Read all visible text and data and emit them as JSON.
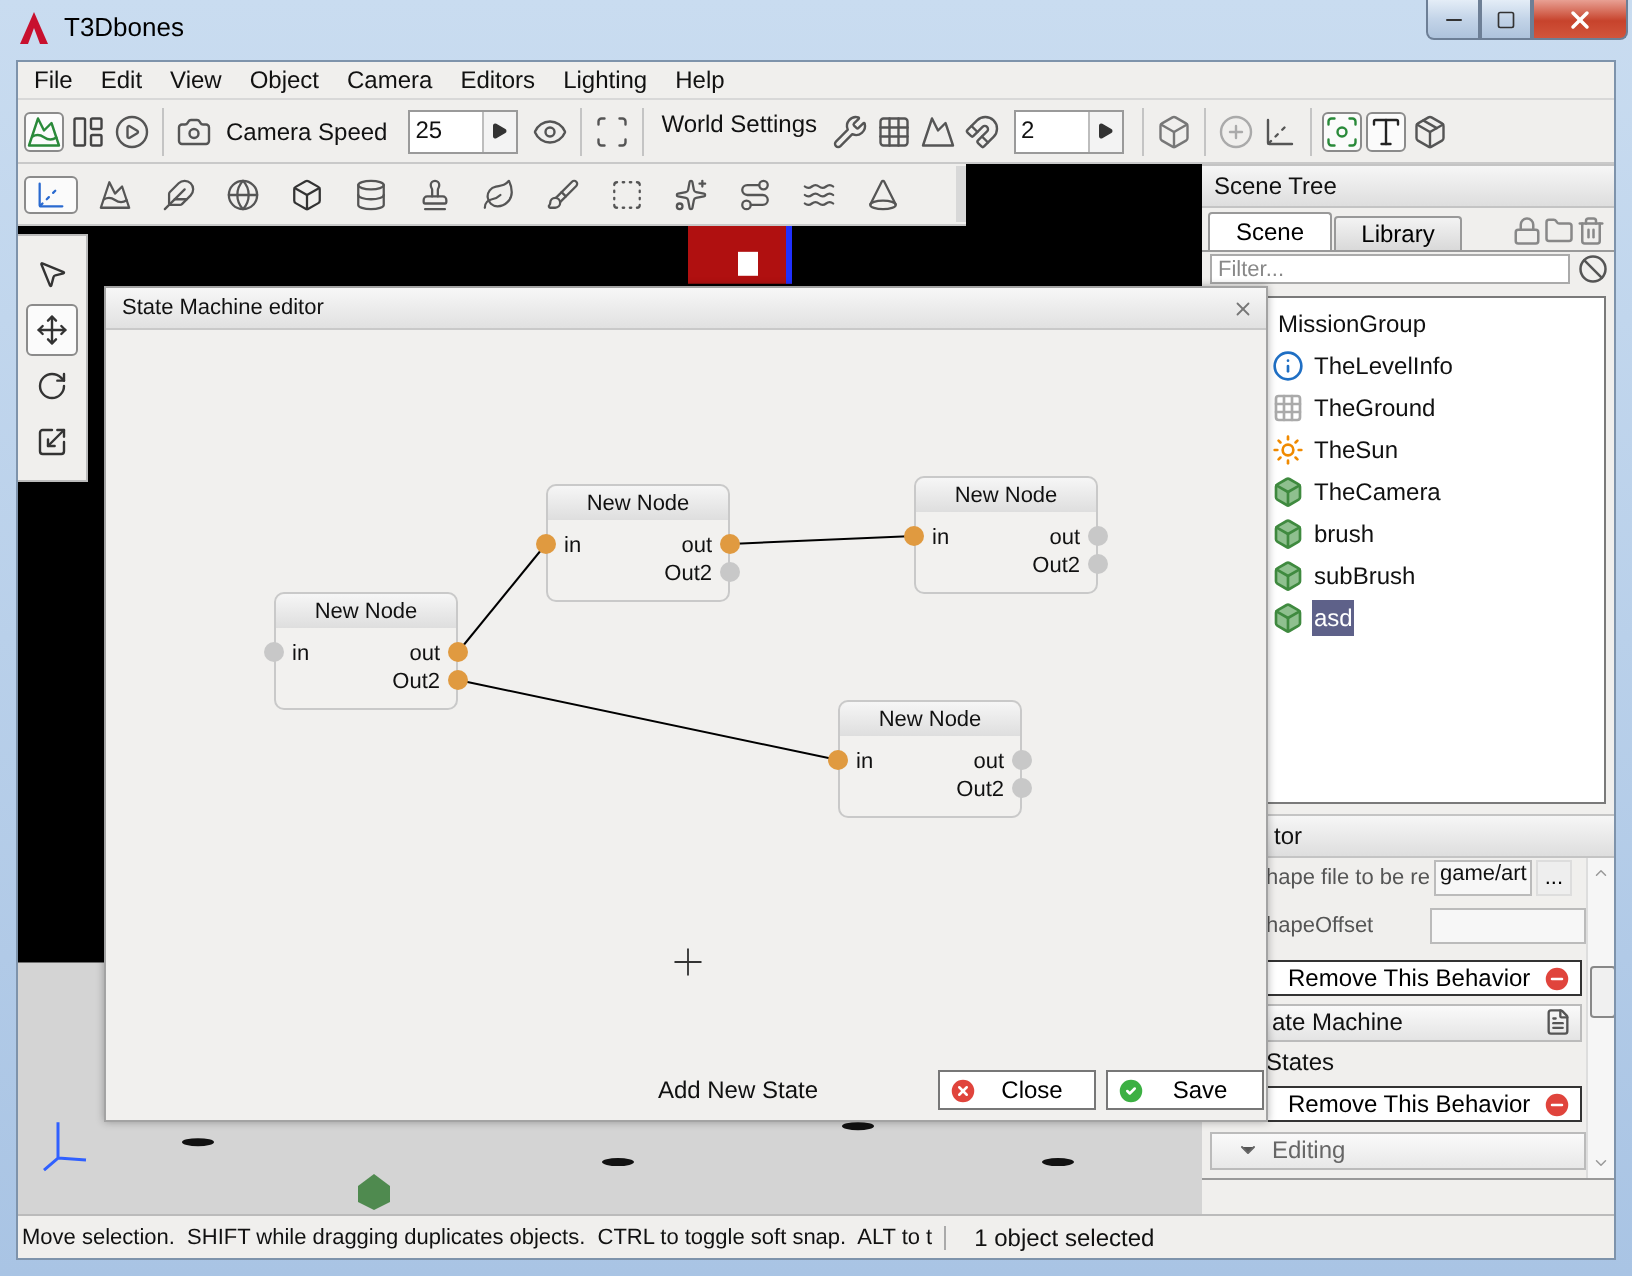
{
  "window": {
    "title": "T3Dbones"
  },
  "menu": [
    "File",
    "Edit",
    "View",
    "Object",
    "Camera",
    "Editors",
    "Lighting",
    "Help"
  ],
  "toolbar": {
    "items": [
      {
        "kind": "tool",
        "selected": true
      },
      {
        "kind": "tool",
        "selected": false
      },
      {
        "kind": "tool",
        "selected": false
      },
      {
        "kind": "separator"
      },
      {
        "kind": "tool",
        "selected": false
      },
      {
        "kind": "label",
        "text": "Camera Speed"
      },
      {
        "kind": "spin",
        "value": "25"
      },
      {
        "kind": "tool",
        "selected": false
      },
      {
        "kind": "separator"
      },
      {
        "kind": "tool",
        "selected": false
      },
      {
        "kind": "separator"
      },
      {
        "kind": "label",
        "text": "World Settings"
      },
      {
        "kind": "tool",
        "selected": false
      },
      {
        "kind": "tool",
        "selected": false
      },
      {
        "kind": "tool",
        "selected": false
      },
      {
        "kind": "tool",
        "selected": false
      },
      {
        "kind": "spin",
        "value": "2"
      },
      {
        "kind": "separator"
      },
      {
        "kind": "tool",
        "selected": false
      },
      {
        "kind": "separator"
      },
      {
        "kind": "tool",
        "selected": false
      },
      {
        "kind": "tool",
        "selected": false
      },
      {
        "kind": "separator"
      },
      {
        "kind": "tool",
        "selected": true
      },
      {
        "kind": "tool",
        "selected": true
      },
      {
        "kind": "tool",
        "selected": false
      }
    ]
  },
  "palette": [
    {
      "selected": true
    },
    {
      "selected": false
    },
    {
      "selected": false
    },
    {
      "selected": false
    },
    {
      "selected": false
    },
    {
      "selected": false
    },
    {
      "selected": false
    },
    {
      "selected": false
    },
    {
      "selected": false
    },
    {
      "selected": false
    },
    {
      "selected": false
    },
    {
      "selected": false
    },
    {
      "selected": false
    },
    {
      "selected": false
    }
  ],
  "side_tools": [
    {
      "selected": false
    },
    {
      "selected": true
    },
    {
      "selected": false
    },
    {
      "selected": false
    }
  ],
  "scene_tree": {
    "title": "Scene Tree",
    "tabs": [
      {
        "label": "Scene",
        "selected": true
      },
      {
        "label": "Library",
        "selected": false
      }
    ],
    "filter": {
      "placeholder": "Filter..."
    },
    "tree": [
      {
        "label": "MissionGroup",
        "children": [
          {
            "label": "TheLevelInfo",
            "kind": "info",
            "selected": false
          },
          {
            "label": "TheGround",
            "kind": "grid",
            "selected": false
          },
          {
            "label": "TheSun",
            "kind": "sun",
            "selected": false
          },
          {
            "label": "TheCamera",
            "kind": "object",
            "selected": false
          },
          {
            "label": "brush",
            "kind": "object",
            "selected": false
          },
          {
            "label": "subBrush",
            "kind": "object",
            "selected": false
          },
          {
            "label": "asd",
            "kind": "object",
            "selected": true
          }
        ]
      }
    ]
  },
  "inspector": {
    "title": "tor",
    "rows": [
      {
        "kind": "file",
        "label": "hape file to be re",
        "value": "game/art",
        "button": "..."
      },
      {
        "kind": "field",
        "label": "hapeOffset"
      },
      {
        "kind": "remove",
        "label": "Remove This Behavior"
      },
      {
        "kind": "behavior",
        "label": "ate Machine"
      },
      {
        "kind": "text",
        "label": "States"
      },
      {
        "kind": "remove",
        "label": "Remove This Behavior"
      },
      {
        "kind": "section",
        "label": "Editing",
        "expanded": true
      }
    ]
  },
  "dialog": {
    "title": "State Machine editor",
    "nodes": [
      {
        "title": "New Node",
        "inputs": [
          {
            "label": "in",
            "connected": false
          }
        ],
        "outputs": [
          {
            "label": "out",
            "connected": true
          },
          {
            "label": "Out2",
            "connected": true
          }
        ]
      },
      {
        "title": "New Node",
        "inputs": [
          {
            "label": "in",
            "connected": true
          }
        ],
        "outputs": [
          {
            "label": "out",
            "connected": true
          },
          {
            "label": "Out2",
            "connected": false
          }
        ]
      },
      {
        "title": "New Node",
        "inputs": [
          {
            "label": "in",
            "connected": true
          }
        ],
        "outputs": [
          {
            "label": "out",
            "connected": false
          },
          {
            "label": "Out2",
            "connected": false
          }
        ]
      },
      {
        "title": "New Node",
        "inputs": [
          {
            "label": "in",
            "connected": true
          }
        ],
        "outputs": [
          {
            "label": "out",
            "connected": false
          },
          {
            "label": "Out2",
            "connected": false
          }
        ]
      }
    ],
    "add_label": "Add New State",
    "buttons": [
      {
        "label": "Close",
        "kind": "close"
      },
      {
        "label": "Save",
        "kind": "save"
      }
    ]
  },
  "status_bar": {
    "message": "Move selection.  SHIFT while dragging duplicates objects.  CTRL to toggle soft snap.  ALT to t",
    "selection": "1 object selected"
  }
}
